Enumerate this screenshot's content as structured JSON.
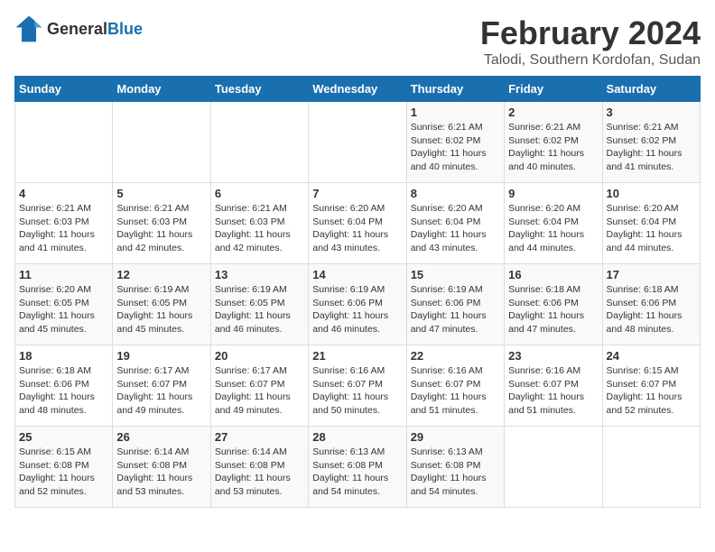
{
  "logo": {
    "text_general": "General",
    "text_blue": "Blue"
  },
  "title": "February 2024",
  "subtitle": "Talodi, Southern Kordofan, Sudan",
  "days_header": [
    "Sunday",
    "Monday",
    "Tuesday",
    "Wednesday",
    "Thursday",
    "Friday",
    "Saturday"
  ],
  "weeks": [
    [
      {
        "day": "",
        "sunrise": "",
        "sunset": "",
        "daylight": ""
      },
      {
        "day": "",
        "sunrise": "",
        "sunset": "",
        "daylight": ""
      },
      {
        "day": "",
        "sunrise": "",
        "sunset": "",
        "daylight": ""
      },
      {
        "day": "",
        "sunrise": "",
        "sunset": "",
        "daylight": ""
      },
      {
        "day": "1",
        "sunrise": "Sunrise: 6:21 AM",
        "sunset": "Sunset: 6:02 PM",
        "daylight": "Daylight: 11 hours and 40 minutes."
      },
      {
        "day": "2",
        "sunrise": "Sunrise: 6:21 AM",
        "sunset": "Sunset: 6:02 PM",
        "daylight": "Daylight: 11 hours and 40 minutes."
      },
      {
        "day": "3",
        "sunrise": "Sunrise: 6:21 AM",
        "sunset": "Sunset: 6:02 PM",
        "daylight": "Daylight: 11 hours and 41 minutes."
      }
    ],
    [
      {
        "day": "4",
        "sunrise": "Sunrise: 6:21 AM",
        "sunset": "Sunset: 6:03 PM",
        "daylight": "Daylight: 11 hours and 41 minutes."
      },
      {
        "day": "5",
        "sunrise": "Sunrise: 6:21 AM",
        "sunset": "Sunset: 6:03 PM",
        "daylight": "Daylight: 11 hours and 42 minutes."
      },
      {
        "day": "6",
        "sunrise": "Sunrise: 6:21 AM",
        "sunset": "Sunset: 6:03 PM",
        "daylight": "Daylight: 11 hours and 42 minutes."
      },
      {
        "day": "7",
        "sunrise": "Sunrise: 6:20 AM",
        "sunset": "Sunset: 6:04 PM",
        "daylight": "Daylight: 11 hours and 43 minutes."
      },
      {
        "day": "8",
        "sunrise": "Sunrise: 6:20 AM",
        "sunset": "Sunset: 6:04 PM",
        "daylight": "Daylight: 11 hours and 43 minutes."
      },
      {
        "day": "9",
        "sunrise": "Sunrise: 6:20 AM",
        "sunset": "Sunset: 6:04 PM",
        "daylight": "Daylight: 11 hours and 44 minutes."
      },
      {
        "day": "10",
        "sunrise": "Sunrise: 6:20 AM",
        "sunset": "Sunset: 6:04 PM",
        "daylight": "Daylight: 11 hours and 44 minutes."
      }
    ],
    [
      {
        "day": "11",
        "sunrise": "Sunrise: 6:20 AM",
        "sunset": "Sunset: 6:05 PM",
        "daylight": "Daylight: 11 hours and 45 minutes."
      },
      {
        "day": "12",
        "sunrise": "Sunrise: 6:19 AM",
        "sunset": "Sunset: 6:05 PM",
        "daylight": "Daylight: 11 hours and 45 minutes."
      },
      {
        "day": "13",
        "sunrise": "Sunrise: 6:19 AM",
        "sunset": "Sunset: 6:05 PM",
        "daylight": "Daylight: 11 hours and 46 minutes."
      },
      {
        "day": "14",
        "sunrise": "Sunrise: 6:19 AM",
        "sunset": "Sunset: 6:06 PM",
        "daylight": "Daylight: 11 hours and 46 minutes."
      },
      {
        "day": "15",
        "sunrise": "Sunrise: 6:19 AM",
        "sunset": "Sunset: 6:06 PM",
        "daylight": "Daylight: 11 hours and 47 minutes."
      },
      {
        "day": "16",
        "sunrise": "Sunrise: 6:18 AM",
        "sunset": "Sunset: 6:06 PM",
        "daylight": "Daylight: 11 hours and 47 minutes."
      },
      {
        "day": "17",
        "sunrise": "Sunrise: 6:18 AM",
        "sunset": "Sunset: 6:06 PM",
        "daylight": "Daylight: 11 hours and 48 minutes."
      }
    ],
    [
      {
        "day": "18",
        "sunrise": "Sunrise: 6:18 AM",
        "sunset": "Sunset: 6:06 PM",
        "daylight": "Daylight: 11 hours and 48 minutes."
      },
      {
        "day": "19",
        "sunrise": "Sunrise: 6:17 AM",
        "sunset": "Sunset: 6:07 PM",
        "daylight": "Daylight: 11 hours and 49 minutes."
      },
      {
        "day": "20",
        "sunrise": "Sunrise: 6:17 AM",
        "sunset": "Sunset: 6:07 PM",
        "daylight": "Daylight: 11 hours and 49 minutes."
      },
      {
        "day": "21",
        "sunrise": "Sunrise: 6:16 AM",
        "sunset": "Sunset: 6:07 PM",
        "daylight": "Daylight: 11 hours and 50 minutes."
      },
      {
        "day": "22",
        "sunrise": "Sunrise: 6:16 AM",
        "sunset": "Sunset: 6:07 PM",
        "daylight": "Daylight: 11 hours and 51 minutes."
      },
      {
        "day": "23",
        "sunrise": "Sunrise: 6:16 AM",
        "sunset": "Sunset: 6:07 PM",
        "daylight": "Daylight: 11 hours and 51 minutes."
      },
      {
        "day": "24",
        "sunrise": "Sunrise: 6:15 AM",
        "sunset": "Sunset: 6:07 PM",
        "daylight": "Daylight: 11 hours and 52 minutes."
      }
    ],
    [
      {
        "day": "25",
        "sunrise": "Sunrise: 6:15 AM",
        "sunset": "Sunset: 6:08 PM",
        "daylight": "Daylight: 11 hours and 52 minutes."
      },
      {
        "day": "26",
        "sunrise": "Sunrise: 6:14 AM",
        "sunset": "Sunset: 6:08 PM",
        "daylight": "Daylight: 11 hours and 53 minutes."
      },
      {
        "day": "27",
        "sunrise": "Sunrise: 6:14 AM",
        "sunset": "Sunset: 6:08 PM",
        "daylight": "Daylight: 11 hours and 53 minutes."
      },
      {
        "day": "28",
        "sunrise": "Sunrise: 6:13 AM",
        "sunset": "Sunset: 6:08 PM",
        "daylight": "Daylight: 11 hours and 54 minutes."
      },
      {
        "day": "29",
        "sunrise": "Sunrise: 6:13 AM",
        "sunset": "Sunset: 6:08 PM",
        "daylight": "Daylight: 11 hours and 54 minutes."
      },
      {
        "day": "",
        "sunrise": "",
        "sunset": "",
        "daylight": ""
      },
      {
        "day": "",
        "sunrise": "",
        "sunset": "",
        "daylight": ""
      }
    ]
  ]
}
